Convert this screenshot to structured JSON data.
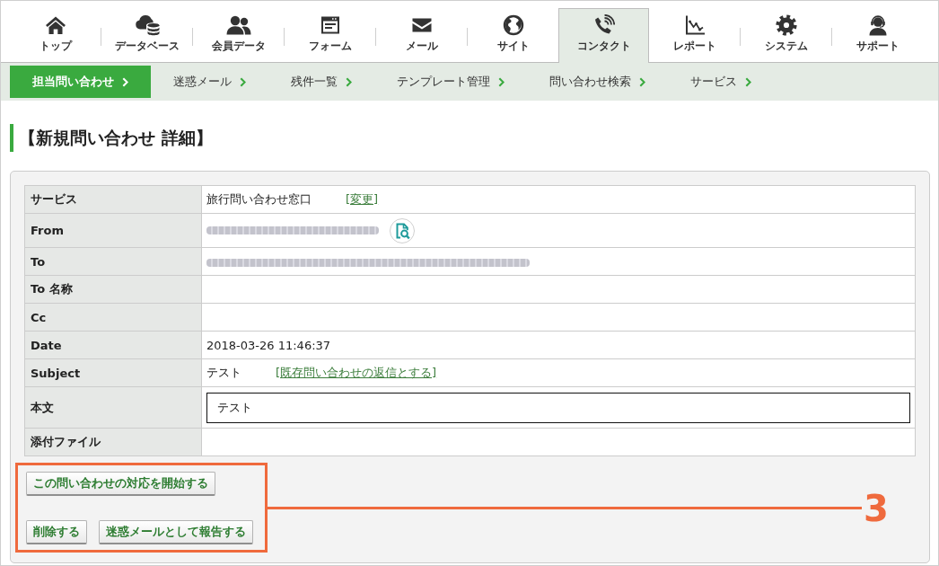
{
  "top_nav": {
    "items": [
      {
        "label": "トップ",
        "selected": false
      },
      {
        "label": "データベース",
        "selected": false
      },
      {
        "label": "会員データ",
        "selected": false
      },
      {
        "label": "フォーム",
        "selected": false
      },
      {
        "label": "メール",
        "selected": false
      },
      {
        "label": "サイト",
        "selected": false
      },
      {
        "label": "コンタクト",
        "selected": true
      },
      {
        "label": "レポート",
        "selected": false
      },
      {
        "label": "システム",
        "selected": false
      },
      {
        "label": "サポート",
        "selected": false
      }
    ]
  },
  "sub_nav": {
    "items": [
      {
        "label": "担当問い合わせ",
        "selected": true
      },
      {
        "label": "迷惑メール",
        "selected": false
      },
      {
        "label": "残件一覧",
        "selected": false
      },
      {
        "label": "テンプレート管理",
        "selected": false
      },
      {
        "label": "問い合わせ検索",
        "selected": false
      },
      {
        "label": "サービス",
        "selected": false
      }
    ]
  },
  "page_title": "【新規問い合わせ 詳細】",
  "detail_table": {
    "rows": [
      {
        "label": "サービス",
        "kind": "text",
        "value": "旅行問い合わせ窓口",
        "link": "[変更]"
      },
      {
        "label": "From",
        "kind": "blurred",
        "lookup": true
      },
      {
        "label": "To",
        "kind": "blurred"
      },
      {
        "label": "To 名称",
        "kind": "text"
      },
      {
        "label": "Cc",
        "kind": "text"
      },
      {
        "label": "Date",
        "kind": "text",
        "value": "2018-03-26 11:46:37"
      },
      {
        "label": "Subject",
        "kind": "text",
        "value": "テスト",
        "link": "[既存問い合わせの返信とする]"
      },
      {
        "label": "本文",
        "kind": "box",
        "value": "テスト"
      },
      {
        "label": "添付ファイル",
        "kind": "text"
      }
    ]
  },
  "actions": [
    {
      "buttons": [
        "この問い合わせの対応を開始する"
      ]
    },
    {
      "buttons": [
        "削除する",
        "迷惑メールとして報告する"
      ]
    }
  ],
  "annotation": {
    "label": "3"
  }
}
